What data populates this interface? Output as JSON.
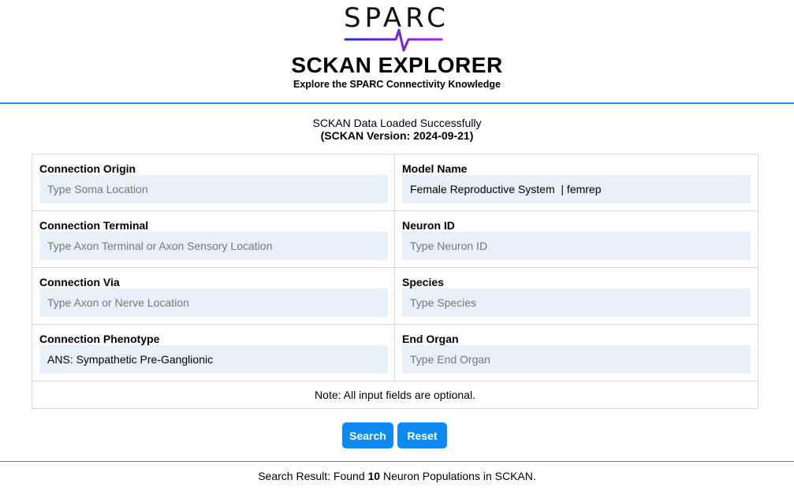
{
  "header": {
    "logo_text": "SPARC",
    "title": "SCKAN EXPLORER",
    "subtitle": "Explore the SPARC Connectivity Knowledge"
  },
  "status": {
    "message": "SCKAN Data Loaded Successfully",
    "version": "(SCKAN Version: 2024-09-21)"
  },
  "form": {
    "fields": [
      {
        "label": "Connection Origin",
        "value": "",
        "placeholder": "Type Soma Location"
      },
      {
        "label": "Model Name",
        "value": "Female Reproductive System  | femrep",
        "placeholder": ""
      },
      {
        "label": "Connection Terminal",
        "value": "",
        "placeholder": "Type Axon Terminal or Axon Sensory Location"
      },
      {
        "label": "Neuron ID",
        "value": "",
        "placeholder": "Type Neuron ID"
      },
      {
        "label": "Connection Via",
        "value": "",
        "placeholder": "Type Axon or Nerve Location"
      },
      {
        "label": "Species",
        "value": "",
        "placeholder": "Type Species"
      },
      {
        "label": "Connection Phenotype",
        "value": "ANS: Sympathetic Pre-Ganglionic",
        "placeholder": ""
      },
      {
        "label": "End Organ",
        "value": "",
        "placeholder": "Type End Organ"
      }
    ],
    "note": "Note: All input fields are optional."
  },
  "buttons": {
    "search": "Search",
    "reset": "Reset"
  },
  "result": {
    "prefix": "Search Result: Found ",
    "count": "10",
    "suffix": " Neuron Populations in SCKAN."
  },
  "colors": {
    "accent": "#0d8af0",
    "rule": "#2f8fd8",
    "input_bg": "#e8f0fa",
    "logo_gradient_start": "#2a2ad0",
    "logo_gradient_end": "#b21ee0"
  }
}
